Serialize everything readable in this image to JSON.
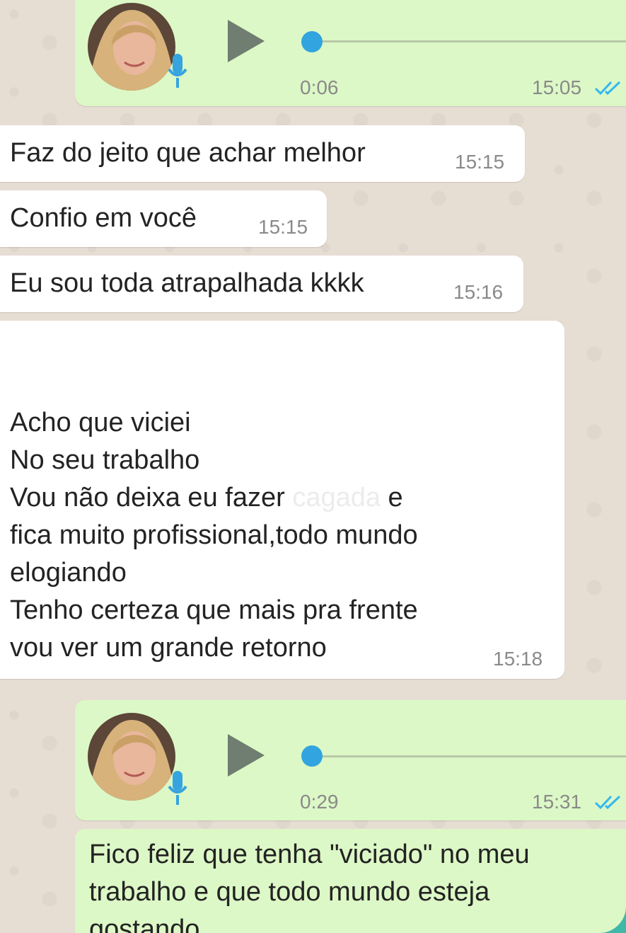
{
  "messages": [
    {
      "type": "voice",
      "direction": "outgoing",
      "duration": "0:06",
      "time": "15:05",
      "read": true
    },
    {
      "type": "text",
      "direction": "incoming",
      "text": "Faz do jeito que achar melhor",
      "time": "15:15"
    },
    {
      "type": "text",
      "direction": "incoming",
      "text": "Confio em você",
      "time": "15:15"
    },
    {
      "type": "text",
      "direction": "incoming",
      "text": "Eu sou toda atrapalhada kkkk",
      "time": "15:16"
    },
    {
      "type": "text",
      "direction": "incoming",
      "lines": [
        "Acho que viciei",
        "No seu trabalho",
        "Vou não deixa eu fazer",
        "cagada",
        "e",
        "fica muito profissional,todo mundo",
        "elogiando",
        "Tenho certeza que mais pra frente",
        "vou ver um grande retorno"
      ],
      "time": "15:18"
    },
    {
      "type": "voice",
      "direction": "outgoing",
      "duration": "0:29",
      "time": "15:31",
      "read": true
    },
    {
      "type": "text",
      "direction": "outgoing",
      "lines": [
        "Fico feliz que tenha \"viciado\" no meu",
        "trabalho e que todo mundo esteja",
        "gostando"
      ]
    }
  ],
  "colors": {
    "incoming_bubble": "#ffffff",
    "outgoing_bubble": "#dcf8c6",
    "chat_background": "#e6ddd3",
    "voice_knob": "#32a4df",
    "read_ticks": "#34b7f1",
    "outer_frame": "#3fb8a8"
  },
  "icons": {
    "play": "play-icon",
    "mic": "microphone-icon",
    "ticks": "double-check-icon",
    "avatar": "contact-avatar"
  }
}
